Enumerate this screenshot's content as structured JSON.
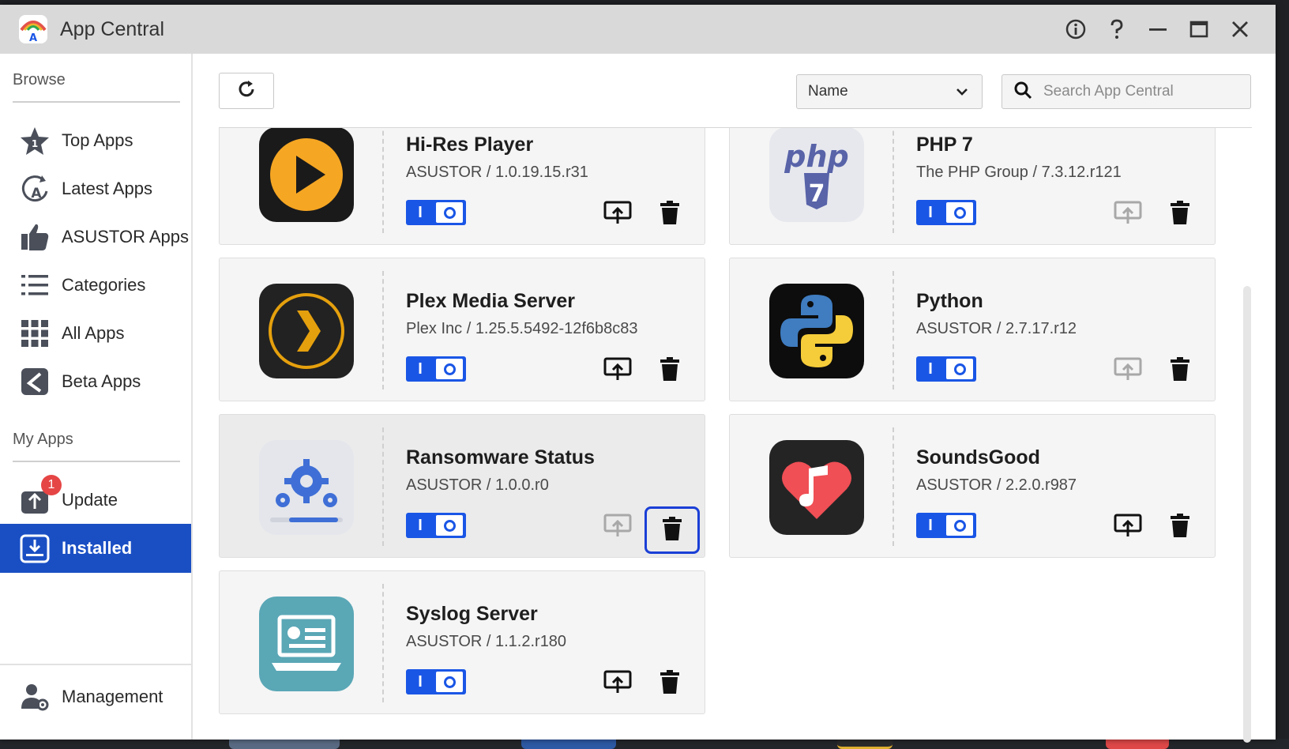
{
  "window": {
    "title": "App Central"
  },
  "sidebar": {
    "browse_label": "Browse",
    "browse_items": [
      {
        "label": "Top Apps",
        "icon": "star-icon"
      },
      {
        "label": "Latest Apps",
        "icon": "latest-icon"
      },
      {
        "label": "ASUSTOR Apps",
        "icon": "thumbs-up-icon"
      },
      {
        "label": "Categories",
        "icon": "list-icon"
      },
      {
        "label": "All Apps",
        "icon": "grid-icon"
      },
      {
        "label": "Beta Apps",
        "icon": "beta-icon"
      }
    ],
    "myapps_label": "My Apps",
    "myapps_items": [
      {
        "label": "Update",
        "icon": "update-icon",
        "badge": "1"
      },
      {
        "label": "Installed",
        "icon": "installed-icon",
        "active": true
      }
    ],
    "management_label": "Management"
  },
  "toolbar": {
    "sort_value": "Name",
    "search_placeholder": "Search App Central"
  },
  "apps": [
    {
      "name": "Hi-Res Player",
      "meta": "ASUSTOR / 1.0.19.15.r31",
      "icon": "hi-res-player-icon",
      "toggle": "I",
      "open_enabled": true
    },
    {
      "name": "PHP 7",
      "meta": "The PHP Group / 7.3.12.r121",
      "icon": "php-icon",
      "toggle": "I",
      "open_enabled": false
    },
    {
      "name": "Plex Media Server",
      "meta": "Plex Inc / 1.25.5.5492-12f6b8c83",
      "icon": "plex-icon",
      "toggle": "I",
      "open_enabled": true
    },
    {
      "name": "Python",
      "meta": "ASUSTOR / 2.7.17.r12",
      "icon": "python-icon",
      "toggle": "I",
      "open_enabled": false
    },
    {
      "name": "Ransomware Status",
      "meta": "ASUSTOR / 1.0.0.r0",
      "icon": "ransomware-icon",
      "toggle": "I",
      "open_enabled": false
    },
    {
      "name": "SoundsGood",
      "meta": "ASUSTOR / 2.2.0.r987",
      "icon": "soundsgood-icon",
      "toggle": "I",
      "open_enabled": true
    },
    {
      "name": "Syslog Server",
      "meta": "ASUSTOR / 1.1.2.r180",
      "icon": "syslog-icon",
      "toggle": "I",
      "open_enabled": true
    }
  ],
  "colors": {
    "accent": "#1a56e6",
    "sidebar_active": "#1a4fc4",
    "badge": "#e64545",
    "focus_ring": "#1a3fd6"
  }
}
